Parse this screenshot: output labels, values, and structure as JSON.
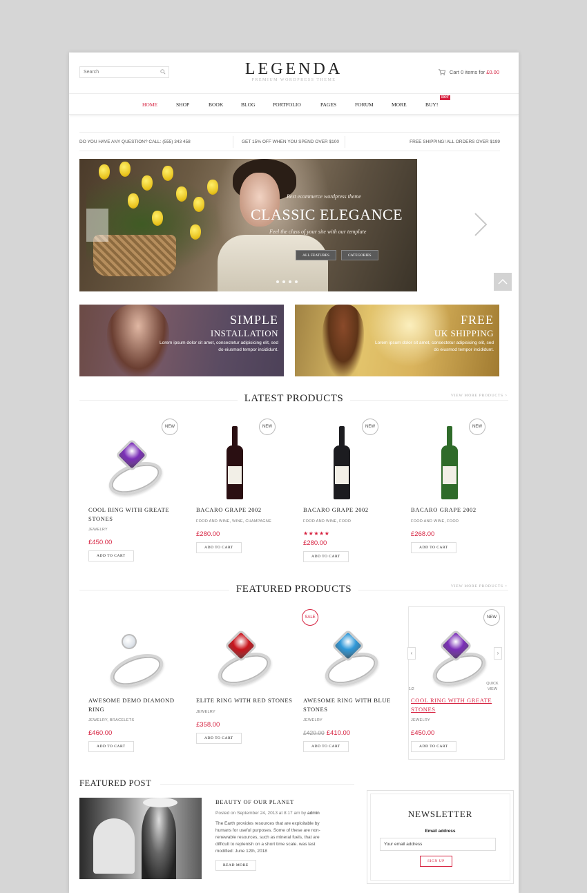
{
  "header": {
    "search_placeholder": "Search",
    "logo": "LEGENDA",
    "tagline": "PREMIUM WORDPRESS THEME",
    "cart_prefix": "Cart 0 items for",
    "cart_price": "£0.00"
  },
  "nav": {
    "items": [
      "HOME",
      "SHOP",
      "BOOK",
      "BLOG",
      "PORTFOLIO",
      "PAGES",
      "FORUM",
      "MORE",
      "BUY!"
    ],
    "hot_badge": "HOT"
  },
  "infobar": {
    "left": "DO YOU HAVE ANY QUESTION? CALL: (555) 343 458",
    "middle": "GET 15% OFF WHEN YOU SPEND OVER $100",
    "right": "FREE SHIPPING! ALL ORDERS OVER $199"
  },
  "slider": {
    "small_text": "Best ecommerce wordpress theme",
    "title": "CLASSIC ELEGANCE",
    "subtitle": "Feel the class of your site with our template",
    "btn_features": "ALL FEATURES",
    "btn_categories": "CATEGORIES"
  },
  "banners": [
    {
      "title": "SIMPLE",
      "title2": "INSTALLATION",
      "text": "Lorem ipsum dolor sit amet, consectetur adipisicing elit, sed do eiusmod tempor incididunt."
    },
    {
      "title": "FREE",
      "title2": "UK SHIPPING",
      "text": "Lorem ipsum dolor sit amet, consectetur adipisicing elit, sed do eiusmod tempor incididunt."
    }
  ],
  "latest": {
    "heading": "LATEST PRODUCTS",
    "view_more": "VIEW MORE PRODUCTS >",
    "products": [
      {
        "name": "COOL RING WITH GREATE STONES",
        "category": "JEWELRY",
        "price": "£450.00",
        "badge": "NEW",
        "button": "ADD TO CART",
        "gem_color": "#7b2fb8"
      },
      {
        "name": "BACARO GRAPE 2002",
        "category": "FOOD AND WINE, WINE, CHAMPAGNE",
        "price": "£280.00",
        "badge": "NEW",
        "button": "ADD TO CART",
        "bottle_color": "#2a0f12"
      },
      {
        "name": "BACARO GRAPE 2002",
        "category": "FOOD AND WINE, FOOD",
        "rating": 5,
        "stars": "★★★★★",
        "price": "£280.00",
        "badge": "NEW",
        "button": "ADD TO CART",
        "bottle_color": "#1c1c20"
      },
      {
        "name": "BACARO GRAPE 2002",
        "category": "FOOD AND WINE, FOOD",
        "price": "£268.00",
        "badge": "NEW",
        "button": "ADD TO CART",
        "bottle_color": "#2f6b2a"
      }
    ]
  },
  "featured": {
    "heading": "FEATURED PRODUCTS",
    "view_more": "VIEW MORE PRODUCTS >",
    "products": [
      {
        "name": "AWESOME DEMO DIAMOND RING",
        "category": "JEWELRY, BRACELETS",
        "price": "£460.00",
        "button": "ADD TO CART",
        "gem": "diamond"
      },
      {
        "name": "ELITE RING WITH RED STONES",
        "category": "JEWELRY",
        "price": "£358.00",
        "button": "ADD TO CART",
        "gem_color": "#c8141c"
      },
      {
        "name": "AWESOME RING WITH BLUE STONES",
        "category": "JEWELRY",
        "old_price": "£420.00",
        "price": "£410.00",
        "badge": "SALE",
        "button": "ADD TO CART",
        "gem_color": "#2f98d8"
      },
      {
        "name": "COOL RING WITH GREATE STONES",
        "category": "JEWELRY",
        "price": "£450.00",
        "badge": "NEW",
        "button": "ADD TO CART",
        "gem_color": "#7b2fb8",
        "pager": "1/2",
        "quick_view": "QUICK VIEW"
      }
    ]
  },
  "featured_post": {
    "heading": "FEATURED POST",
    "title": "BEAUTY OF OUR PLANET",
    "meta_prefix": "Posted on September 24, 2013 at 8:17 am by",
    "author": "admin",
    "text": "The Earth provides resources that are exploitable by humans for useful purposes. Some of these are non-renewable resources, such as mineral fuels, that are difficult to replenish on a short time scale. was last modified: June 12th, 2018",
    "button": "READ MORE"
  },
  "newsletter": {
    "title": "NEWSLETTER",
    "label": "Email address",
    "placeholder": "Your email address",
    "button": "SIGN UP"
  },
  "colors": {
    "accent": "#d6213f"
  }
}
